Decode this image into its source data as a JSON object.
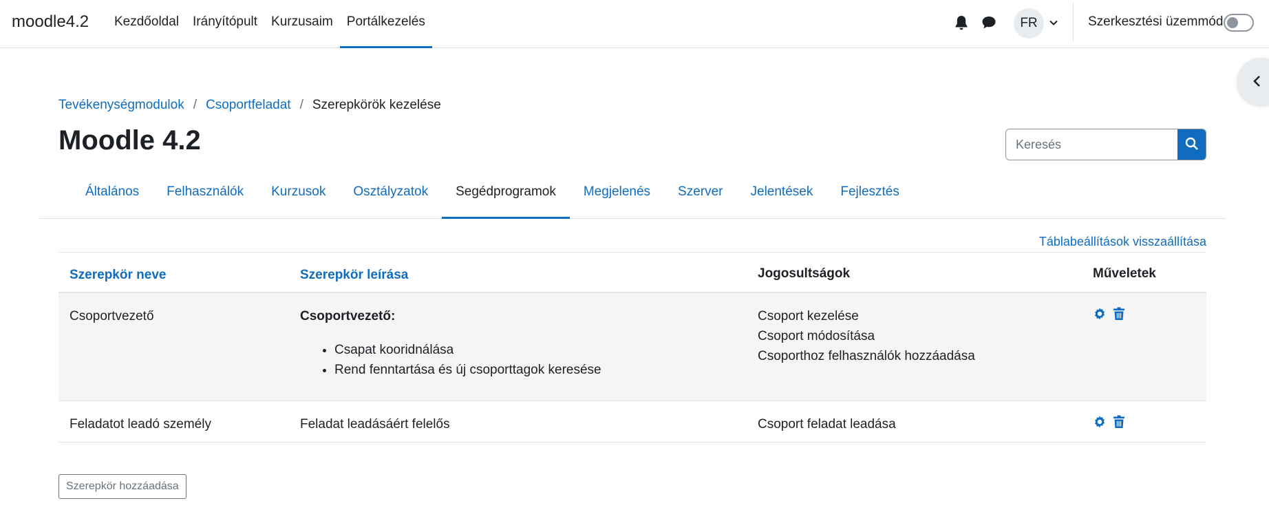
{
  "navbar": {
    "brand": "moodle4.2",
    "items": [
      {
        "label": "Kezdőoldal",
        "active": false
      },
      {
        "label": "Irányítópult",
        "active": false
      },
      {
        "label": "Kurzusaim",
        "active": false
      },
      {
        "label": "Portálkezelés",
        "active": true
      }
    ],
    "avatar_initials": "FR",
    "edit_mode_label": "Szerkesztési üzemmód",
    "edit_mode_on": false,
    "icons": [
      "bell-icon",
      "chat-icon",
      "chevron-down-icon",
      "chevron-left-icon"
    ]
  },
  "breadcrumb": {
    "items": [
      {
        "label": "Tevékenységmodulok",
        "link": true
      },
      {
        "label": "Csoportfeladat",
        "link": true
      },
      {
        "label": "Szerepkörök kezelése",
        "link": false
      }
    ]
  },
  "page_title": "Moodle 4.2",
  "search": {
    "placeholder": "Keresés"
  },
  "tabs": [
    {
      "label": "Általános",
      "active": false
    },
    {
      "label": "Felhasználók",
      "active": false
    },
    {
      "label": "Kurzusok",
      "active": false
    },
    {
      "label": "Osztályzatok",
      "active": false
    },
    {
      "label": "Segédprogramok",
      "active": true
    },
    {
      "label": "Megjelenés",
      "active": false
    },
    {
      "label": "Szerver",
      "active": false
    },
    {
      "label": "Jelentések",
      "active": false
    },
    {
      "label": "Fejlesztés",
      "active": false
    }
  ],
  "table": {
    "reset_label": "Táblabeállítások visszaállítása",
    "headers": {
      "name": "Szerepkör neve",
      "description": "Szerepkör leírása",
      "permissions": "Jogosultságok",
      "actions": "Műveletek"
    },
    "rows": [
      {
        "name": "Csoportvezető",
        "description_title": "Csoportvezető:",
        "description_items": [
          "Csapat kooridnálása",
          "Rend fenntartása és új csoporttagok keresése"
        ],
        "permissions": [
          "Csoport kezelése",
          "Csoport módosítása",
          "Csoporthoz felhasználók hozzáadása"
        ]
      },
      {
        "name": "Feladatot leadó személy",
        "description": "Feladat leadásáért felelős",
        "permissions": [
          "Csoport feladat leadása"
        ]
      }
    ]
  },
  "add_button_label": "Szerepkör hozzáadása",
  "colors": {
    "accent": "#0f6cbf",
    "text": "#1d2125",
    "row_highlight": "#f5f5f5"
  }
}
